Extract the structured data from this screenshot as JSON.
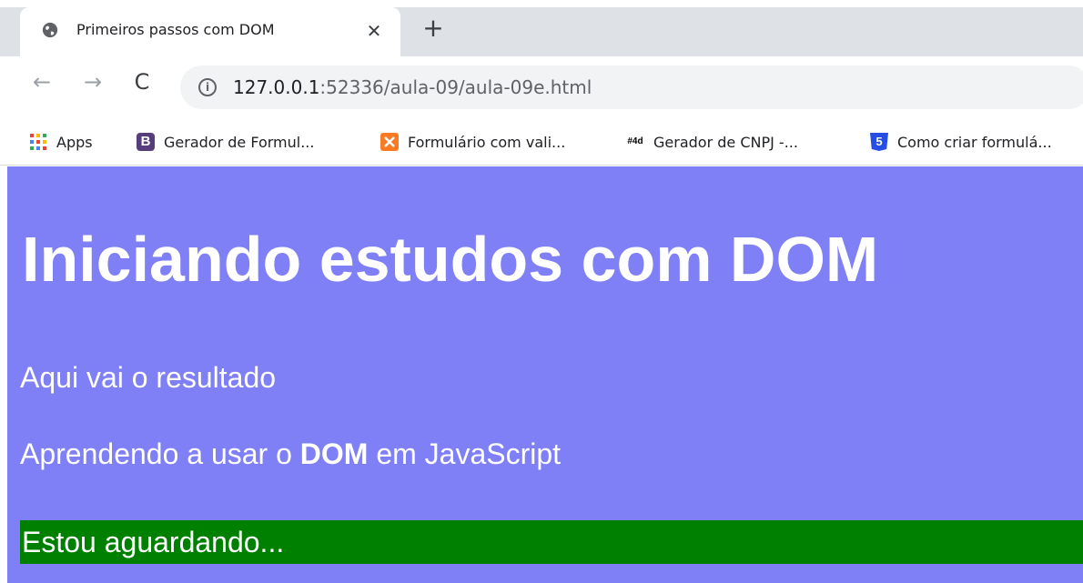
{
  "browser": {
    "tab": {
      "title": "Primeiros passos com DOM",
      "close_glyph": "✕",
      "favicon": "globe-icon"
    },
    "new_tab_glyph": "+",
    "nav": {
      "back_glyph": "←",
      "forward_glyph": "→",
      "reload_glyph": "C"
    },
    "omnibox": {
      "info_glyph": "i",
      "url_host": "127.0.0.1",
      "url_rest": ":52336/aula-09/aula-09e.html"
    },
    "bookmarks": [
      {
        "label": "Apps",
        "icon": "apps-grid-icon"
      },
      {
        "label": "Gerador de Formul...",
        "icon": "bootstrap-icon",
        "badge": "B"
      },
      {
        "label": "Formulário com vali...",
        "icon": "xampp-icon"
      },
      {
        "label": "Gerador de CNPJ -...",
        "icon": "4devs-icon",
        "badge": "#4d"
      },
      {
        "label": "Como criar formulá...",
        "icon": "html5-icon",
        "badge": "5"
      }
    ]
  },
  "page": {
    "background": "#7f7ff6",
    "heading": "Iniciando estudos com DOM",
    "paragraph1": "Aqui vai o resultado",
    "paragraph2": {
      "before": "Aprendendo a usar o ",
      "bold": "DOM",
      "after": " em JavaScript"
    },
    "waiting_box": {
      "text": "Estou aguardando...",
      "background": "#008000"
    }
  }
}
